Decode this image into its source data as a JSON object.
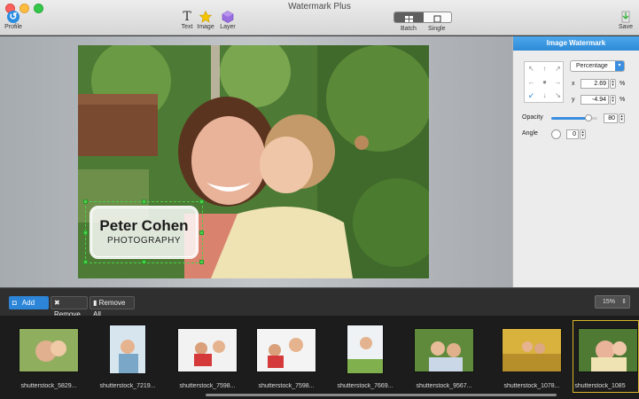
{
  "window": {
    "title": "Watermark Plus"
  },
  "toolbar": {
    "profile_label": "Profile",
    "text_label": "Text",
    "image_label": "Image",
    "layer_label": "Layer",
    "batch_label": "Batch",
    "single_label": "Single",
    "save_label": "Save",
    "mode": "Batch"
  },
  "preview": {
    "watermark_name": "Peter Cohen",
    "watermark_sub": "PHOTOGRAPHY"
  },
  "panel": {
    "title": "Image Watermark",
    "unit": "Percentage",
    "x_label": "x",
    "x_value": "2.69",
    "y_label": "y",
    "y_value": "-4.94",
    "pct": "%",
    "opacity_label": "Opacity",
    "opacity_value": "80",
    "opacity_level": 0.8,
    "angle_label": "Angle",
    "angle_value": "0",
    "selected_position": "bottom-left"
  },
  "actions": {
    "add": "Add",
    "remove": "Remove",
    "remove_all": "Remove All",
    "zoom": "15%"
  },
  "thumbnails": [
    {
      "caption": "shutterstock_5829..."
    },
    {
      "caption": "shutterstock_7219..."
    },
    {
      "caption": "shutterstock_7598..."
    },
    {
      "caption": "shutterstock_7598..."
    },
    {
      "caption": "shutterstock_7669..."
    },
    {
      "caption": "shutterstock_9567..."
    },
    {
      "caption": "shutterstock_1078..."
    },
    {
      "caption": "shutterstock_1085"
    }
  ],
  "colors": {
    "accent": "#2d85d8",
    "selection": "#d8b72a",
    "handle": "#4bd04b"
  }
}
